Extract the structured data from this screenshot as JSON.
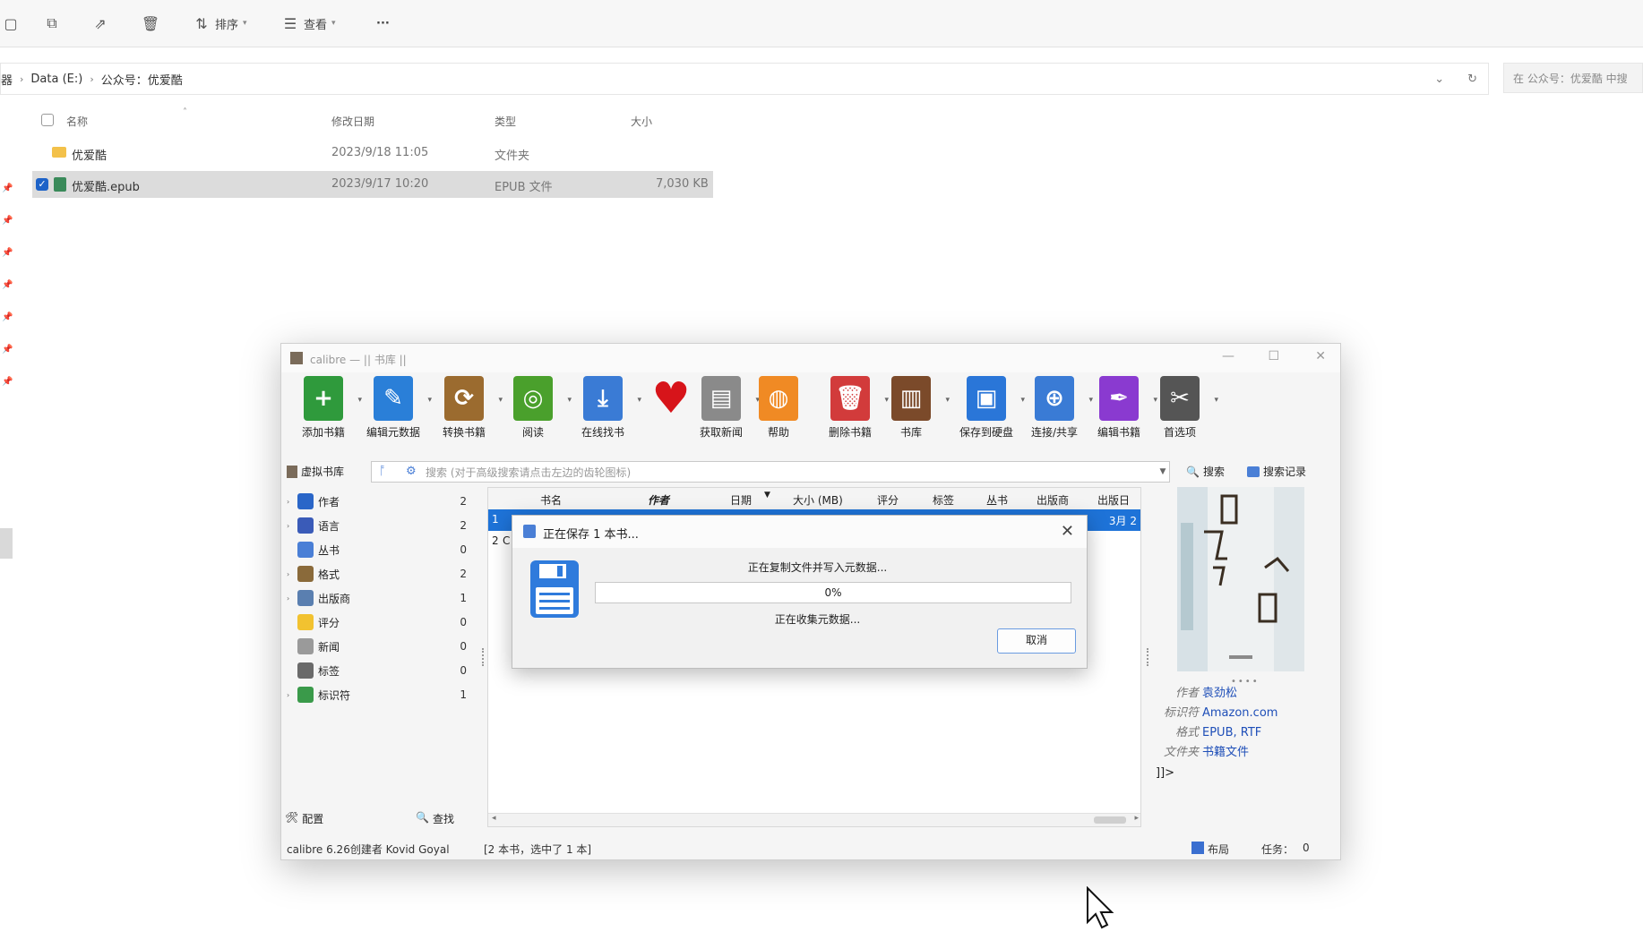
{
  "explorer": {
    "toolbar": {
      "sort_label": "排序",
      "view_label": "查看",
      "more_label": "···"
    },
    "address": {
      "crumb_cut": "器",
      "drive": "Data (E:)",
      "folder": "公众号：优爱酷"
    },
    "search_placeholder": "在 公众号：优爱酷 中搜",
    "columns": {
      "name": "名称",
      "date": "修改日期",
      "type": "类型",
      "size": "大小"
    },
    "rows": [
      {
        "name": "优爱酷",
        "date": "2023/9/18 11:05",
        "type": "文件夹",
        "size": ""
      },
      {
        "name": "优爱酷.epub",
        "date": "2023/9/17 10:20",
        "type": "EPUB 文件",
        "size": "7,030 KB"
      }
    ]
  },
  "calibre": {
    "title": "calibre — || 书库 ||",
    "toolbar": [
      {
        "label": "添加书籍",
        "icon": "add-book-icon",
        "color": "#2f9a3c"
      },
      {
        "label": "编辑元数据",
        "icon": "edit-metadata-icon",
        "color": "#2a7fd8"
      },
      {
        "label": "转换书籍",
        "icon": "convert-book-icon",
        "color": "#9b6b2f"
      },
      {
        "label": "阅读",
        "icon": "read-book-icon",
        "color": "#4aa02c"
      },
      {
        "label": "在线找书",
        "icon": "download-icon",
        "color": "#3a7bd5"
      },
      {
        "label": "",
        "icon": "heart-icon",
        "color": "#d7141a"
      },
      {
        "label": "获取新闻",
        "icon": "news-icon",
        "color": "#8a8a8a"
      },
      {
        "label": "帮助",
        "icon": "help-lifebuoy-icon",
        "color": "#f08a24"
      },
      {
        "label": "删除书籍",
        "icon": "delete-book-icon",
        "color": "#d23b3b"
      },
      {
        "label": "书库",
        "icon": "library-icon",
        "color": "#7b4a2a"
      },
      {
        "label": "保存到硬盘",
        "icon": "save-disk-icon",
        "color": "#2a76d8"
      },
      {
        "label": "连接/共享",
        "icon": "connect-share-icon",
        "color": "#3a7bd5"
      },
      {
        "label": "编辑书籍",
        "icon": "edit-book-icon",
        "color": "#8a3ad0"
      },
      {
        "label": "首选项",
        "icon": "preferences-icon",
        "color": "#555555"
      }
    ],
    "virtual_library": "虚拟书库",
    "search_placeholder": "搜索 (对于高级搜索请点击左边的齿轮图标)",
    "search_button": "搜索",
    "saved_search_button": "搜索记录",
    "tag_browser": [
      {
        "label": "作者",
        "count": "2",
        "expandable": true,
        "color": "#2a66c8"
      },
      {
        "label": "语言",
        "count": "2",
        "expandable": true,
        "color": "#3a5bb8"
      },
      {
        "label": "丛书",
        "count": "0",
        "expandable": false,
        "color": "#4a7fd6"
      },
      {
        "label": "格式",
        "count": "2",
        "expandable": true,
        "color": "#8a6a3a"
      },
      {
        "label": "出版商",
        "count": "1",
        "expandable": true,
        "color": "#5a7fb0"
      },
      {
        "label": "评分",
        "count": "0",
        "expandable": false,
        "color": "#f2c230"
      },
      {
        "label": "新闻",
        "count": "0",
        "expandable": false,
        "color": "#9a9a9a"
      },
      {
        "label": "标签",
        "count": "0",
        "expandable": false,
        "color": "#6a6a6a"
      },
      {
        "label": "标识符",
        "count": "1",
        "expandable": true,
        "color": "#3a9a4a"
      }
    ],
    "columns": [
      "书名",
      "作者",
      "日期",
      "大小 (MB)",
      "评分",
      "标签",
      "丛书",
      "出版商",
      "出版日"
    ],
    "row1_num": "1",
    "row1_date": "3月 2",
    "row2_num": "2",
    "row2_initial": "C",
    "details": [
      {
        "key": "作者",
        "value": "袁劲松"
      },
      {
        "key": "标识符",
        "value": "Amazon.com"
      },
      {
        "key": "格式",
        "value": "EPUB, RTF"
      },
      {
        "key": "文件夹",
        "value": "书籍文件"
      }
    ],
    "details_more": "]]>",
    "configure": "配置",
    "find": "查找",
    "status_left": "calibre 6.26创建者 Kovid Goyal",
    "status_count": "[2 本书，选中了 1 本]",
    "layout_label": "布局",
    "jobs_label": "任务：",
    "jobs_count": "0"
  },
  "dialog": {
    "title": "正在保存 1 本书...",
    "message": "正在复制文件并写入元数据...",
    "progress_text": "0%",
    "progress_value": 0,
    "sub_message": "正在收集元数据...",
    "cancel_label": "取消"
  }
}
